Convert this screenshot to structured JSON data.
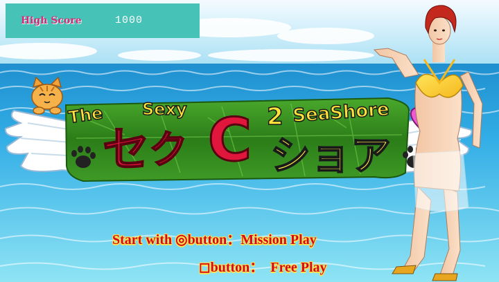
{
  "hud": {
    "high_score_label": "High Score",
    "high_score_value": "1000"
  },
  "logo": {
    "word_the": "The",
    "word_sexy": "Sexy",
    "letter_c": "C",
    "superscript": "2",
    "word_seashore": "SeaShore",
    "kana_se": "セ",
    "kana_ku": "ク",
    "kana_shoa": "ショア"
  },
  "menu": {
    "line1_prefix": "Start  with ",
    "line1_symbol": "◎",
    "line1_rest": "button：Mission Play",
    "line2_symbol": "◻",
    "line2_rest": "button：　Free Play"
  },
  "colors": {
    "sky_top": "#bfe9f5",
    "sea": "#2ea6e0",
    "banner": "#2e8a1c",
    "hud_panel": "#46c2b6",
    "menu_text": "#d40a1c",
    "menu_glow": "#ffe24a"
  },
  "icons": [
    "cat-mascot-icon",
    "heart-icon",
    "paw-icon",
    "mission-circle-button-icon",
    "free-square-button-icon"
  ]
}
